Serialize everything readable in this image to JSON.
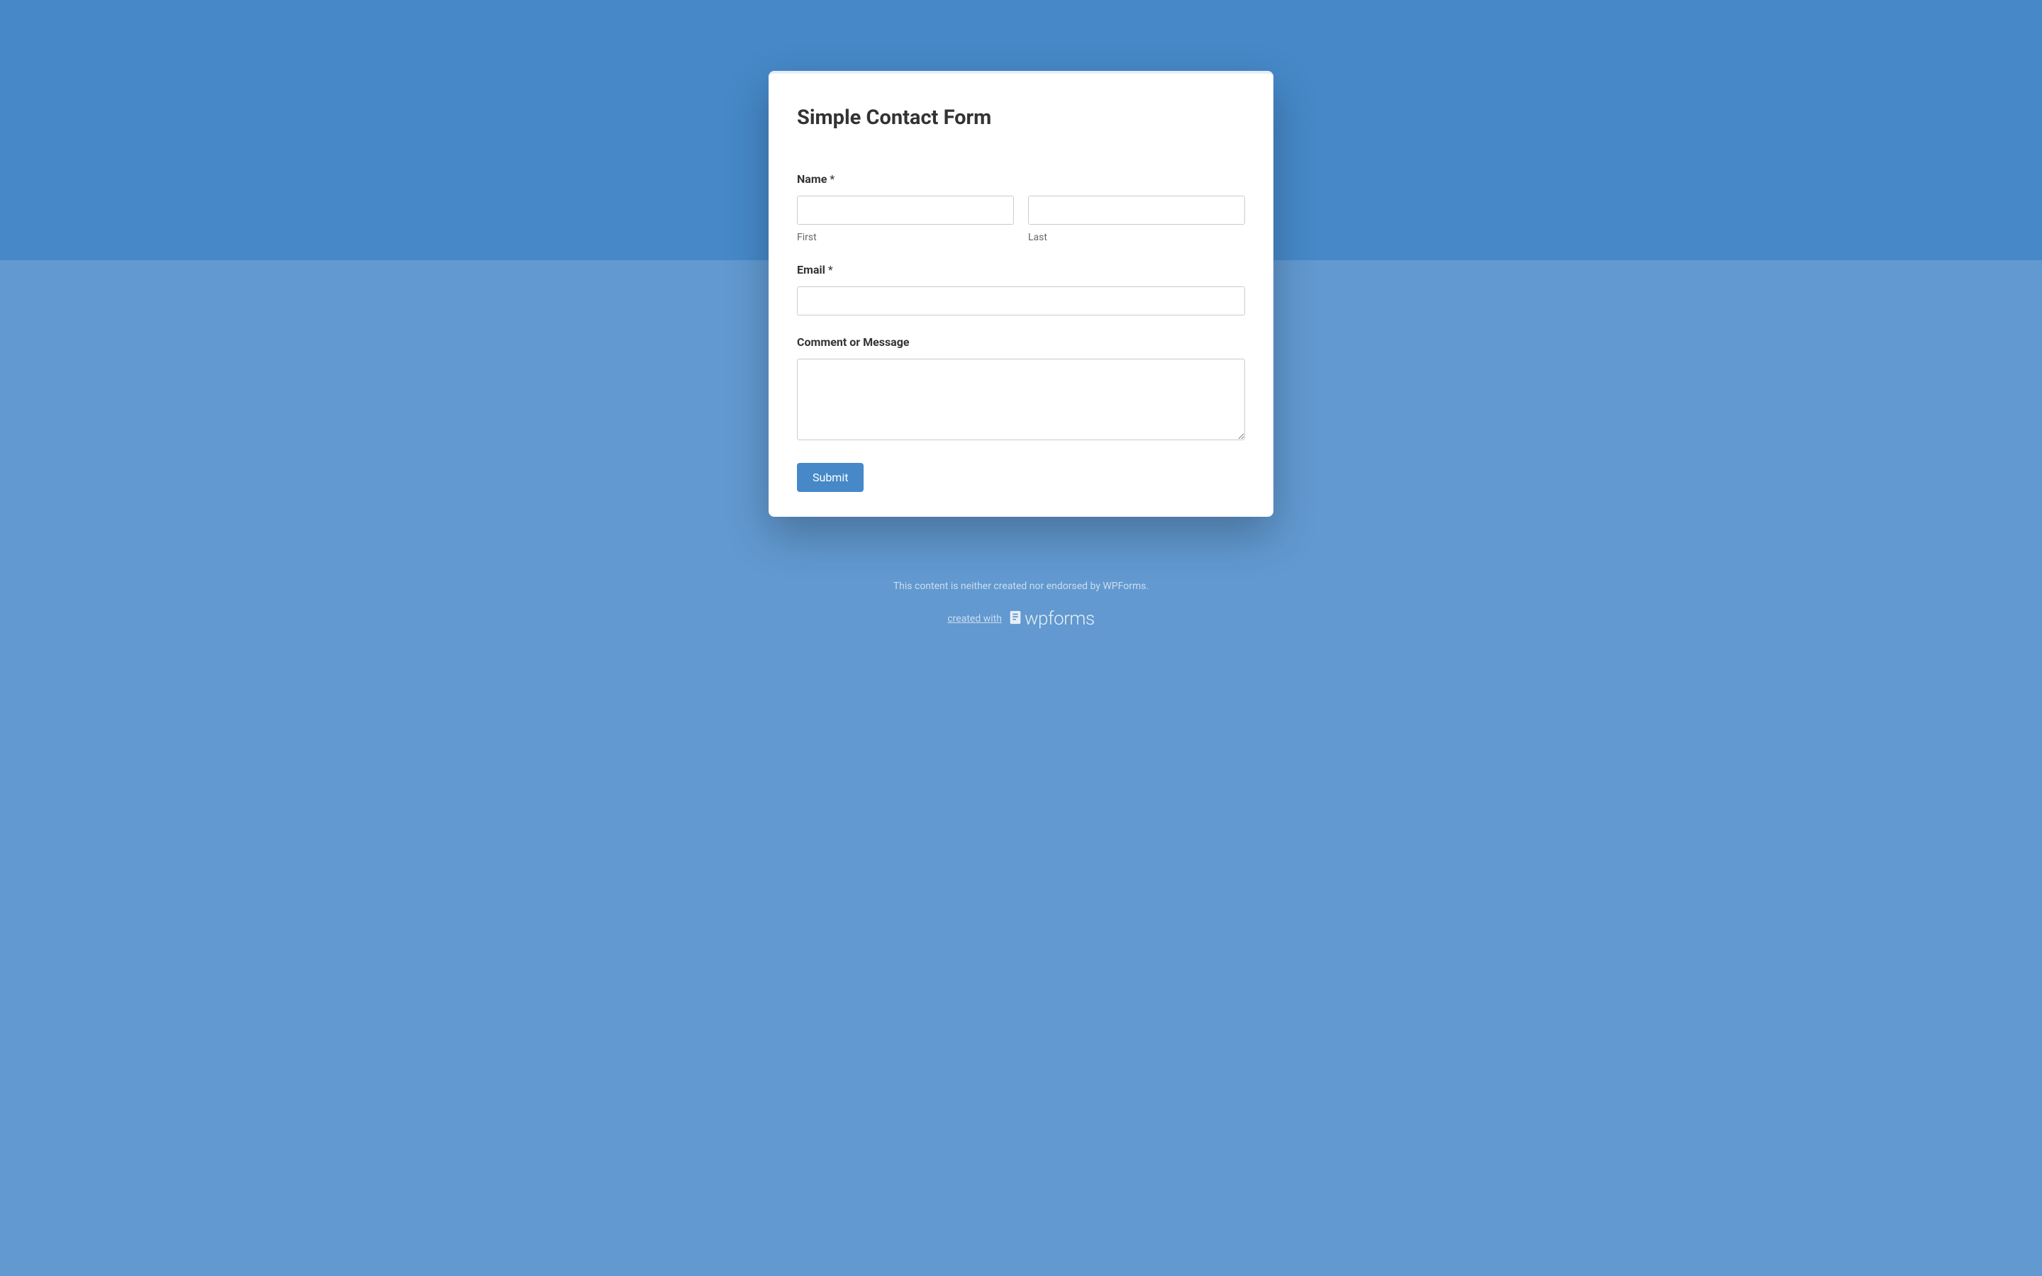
{
  "form": {
    "title": "Simple Contact Form",
    "fields": {
      "name": {
        "label": "Name",
        "required": "*",
        "first_sublabel": "First",
        "last_sublabel": "Last",
        "first_value": "",
        "last_value": ""
      },
      "email": {
        "label": "Email",
        "required": "*",
        "value": ""
      },
      "message": {
        "label": "Comment or Message",
        "value": ""
      }
    },
    "submit_label": "Submit"
  },
  "footer": {
    "disclaimer": "This content is neither created nor endorsed by WPForms.",
    "created_with": "created with",
    "brand": "wpforms"
  },
  "colors": {
    "top_bg": "#4688c8",
    "bottom_bg": "#6199d0",
    "button": "#4688c8",
    "text": "#333333"
  }
}
